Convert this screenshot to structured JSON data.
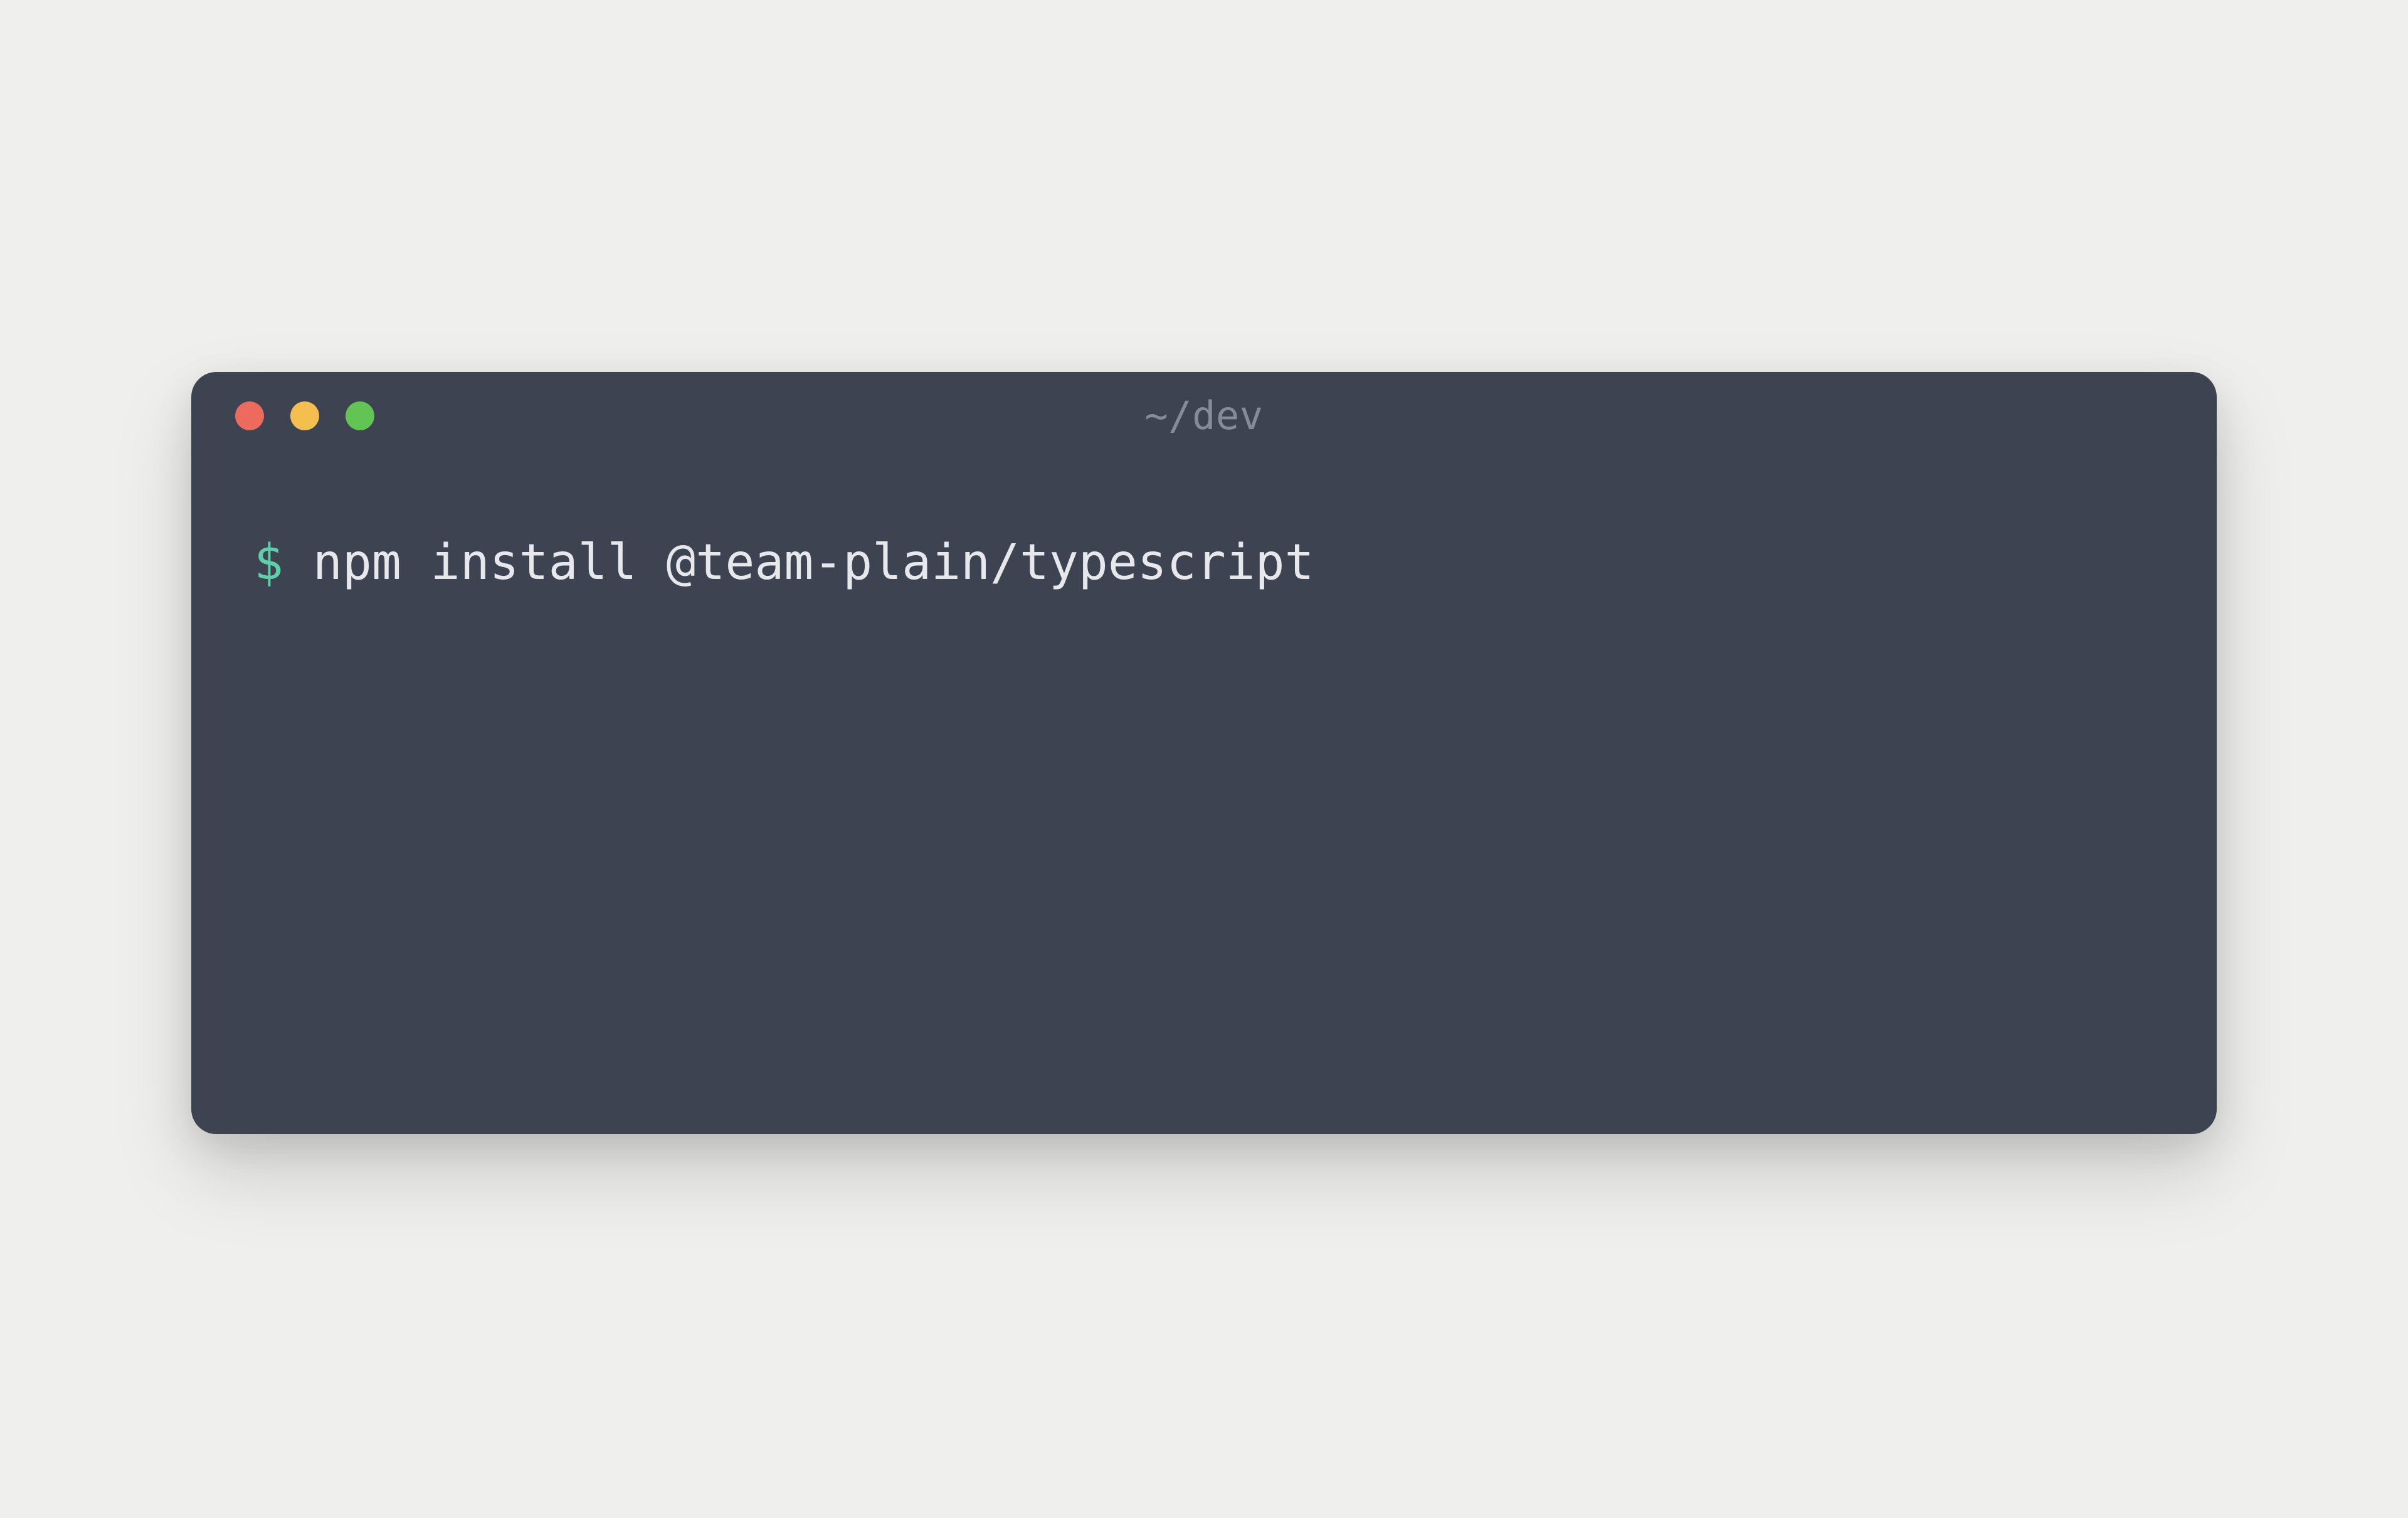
{
  "window": {
    "title": "~/dev"
  },
  "terminal": {
    "prompt": "$ ",
    "command": "npm install @team-plain/typescript"
  },
  "colors": {
    "background": "#efefed",
    "terminal_bg": "#3d4350",
    "prompt": "#5fcfaa",
    "command_text": "#e6e8ec",
    "title_text": "#868c97",
    "close": "#ec6a5e",
    "minimize": "#f4bf4f",
    "maximize": "#61c454"
  }
}
